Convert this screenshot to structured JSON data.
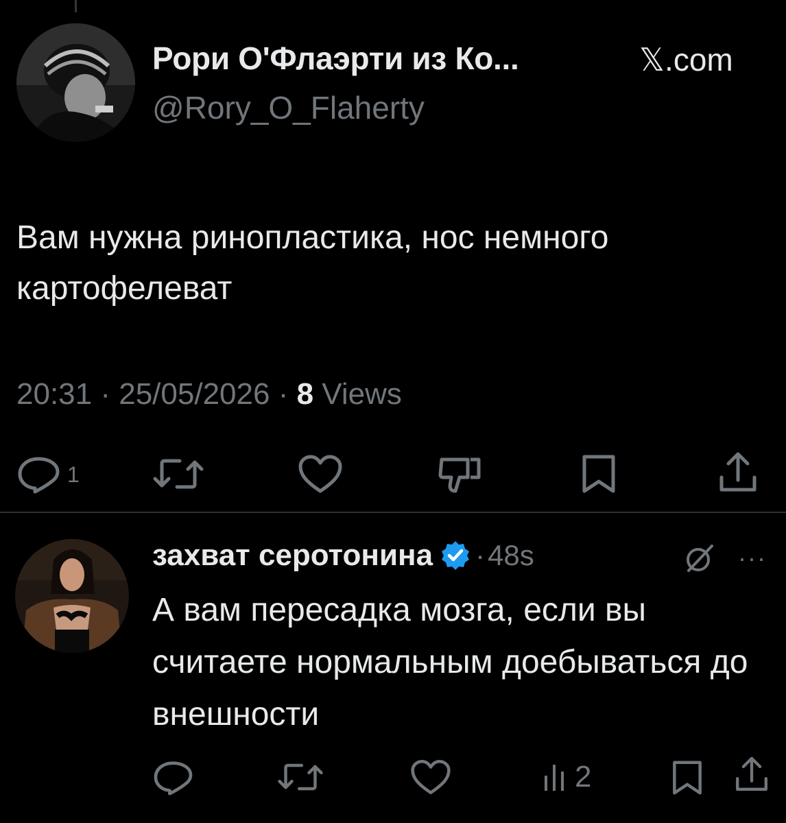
{
  "original_tweet": {
    "display_name": "Рори О'Флаэрти из Ко...",
    "source_label": "𝕏.com",
    "handle": "@Rory_O_Flaherty",
    "text": "Вам нужна ринопластика, нос немного картофелеват",
    "time": "20:31",
    "date": "25/05/2026",
    "separator": "·",
    "views_count": "8",
    "views_label": "Views",
    "actions": [
      {
        "icon": "reply-icon",
        "count": "1"
      },
      {
        "icon": "retweet-icon",
        "count": ""
      },
      {
        "icon": "heart-icon",
        "count": ""
      },
      {
        "icon": "dislike-icon",
        "count": ""
      },
      {
        "icon": "bookmark-icon",
        "count": ""
      },
      {
        "icon": "share-icon",
        "count": ""
      }
    ]
  },
  "reply": {
    "display_name": "захват серотонина",
    "separator": "·",
    "time": "48s",
    "text": "А вам пересадка мозга, если вы считаете нормальным доебываться до внешности",
    "verified_color": "#1d9bf0",
    "icons": [
      "verified-badge-icon",
      "grok-icon",
      "more-icon"
    ],
    "more_label": "···",
    "actions": [
      {
        "icon": "reply-icon",
        "count": ""
      },
      {
        "icon": "retweet-icon",
        "count": ""
      },
      {
        "icon": "heart-icon",
        "count": ""
      },
      {
        "icon": "views-icon",
        "count": "2"
      },
      {
        "icon": "bookmark-icon",
        "count": ""
      },
      {
        "icon": "share-icon",
        "count": ""
      }
    ]
  },
  "colors": {
    "background": "#000000",
    "text_primary": "#e7e9ea",
    "text_secondary": "#71767b",
    "divider": "#2f3336"
  }
}
